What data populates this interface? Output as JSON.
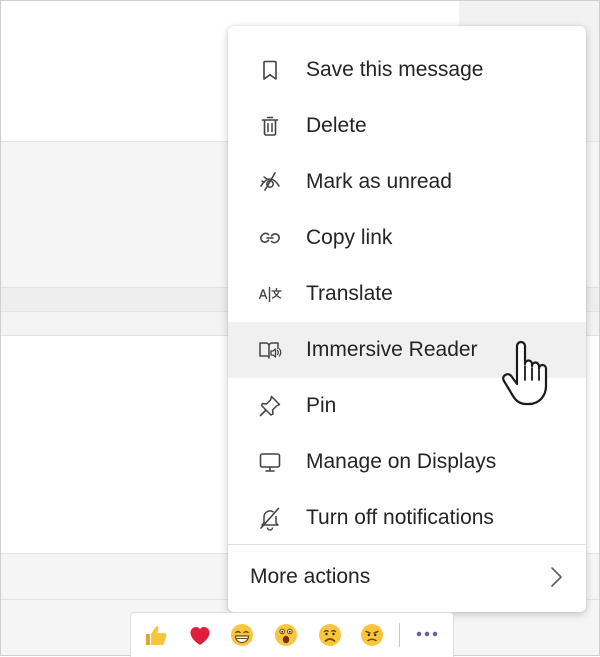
{
  "menu": {
    "items": [
      {
        "label": "Save this message",
        "icon": "bookmark-icon"
      },
      {
        "label": "Delete",
        "icon": "trash-icon"
      },
      {
        "label": "Mark as unread",
        "icon": "unread-icon"
      },
      {
        "label": "Copy link",
        "icon": "link-icon"
      },
      {
        "label": "Translate",
        "icon": "translate-icon"
      },
      {
        "label": "Immersive Reader",
        "icon": "immersive-reader-icon"
      },
      {
        "label": "Pin",
        "icon": "pin-icon"
      },
      {
        "label": "Manage on Displays",
        "icon": "monitor-icon"
      },
      {
        "label": "Turn off notifications",
        "icon": "bell-off-icon"
      }
    ],
    "more_actions_label": "More actions",
    "hovered_item": "Immersive Reader"
  },
  "reactions": [
    {
      "name": "like",
      "icon": "thumbs-up-icon"
    },
    {
      "name": "heart",
      "icon": "heart-icon"
    },
    {
      "name": "laugh",
      "icon": "laughing-face-icon"
    },
    {
      "name": "surprised",
      "icon": "surprised-face-icon"
    },
    {
      "name": "sad",
      "icon": "sad-face-icon"
    },
    {
      "name": "angry",
      "icon": "angry-face-icon"
    }
  ],
  "colors": {
    "accent": "#6264a7",
    "heart": "#e01e3c",
    "emoji_yellow": "#f8c63d",
    "menu_text": "#252423",
    "hover_bg": "#f0f0f0"
  }
}
